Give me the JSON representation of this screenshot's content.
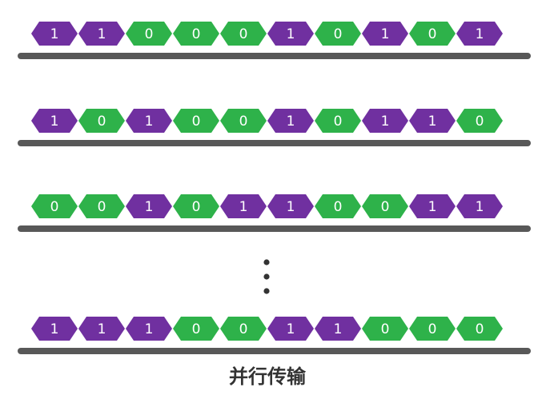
{
  "diagram": {
    "caption": "并行传输",
    "rows": [
      [
        "1",
        "1",
        "0",
        "0",
        "0",
        "1",
        "0",
        "1",
        "0",
        "1"
      ],
      [
        "1",
        "0",
        "1",
        "0",
        "0",
        "1",
        "0",
        "1",
        "1",
        "0"
      ],
      [
        "0",
        "0",
        "1",
        "0",
        "1",
        "1",
        "0",
        "0",
        "1",
        "1"
      ],
      [
        "1",
        "1",
        "1",
        "0",
        "0",
        "1",
        "1",
        "0",
        "0",
        "0"
      ]
    ],
    "ellipsis": "⋮"
  },
  "colors": {
    "bit_1": "#7030a0",
    "bit_0": "#2eb24a",
    "wire": "#585858",
    "text": "#ffffff"
  }
}
